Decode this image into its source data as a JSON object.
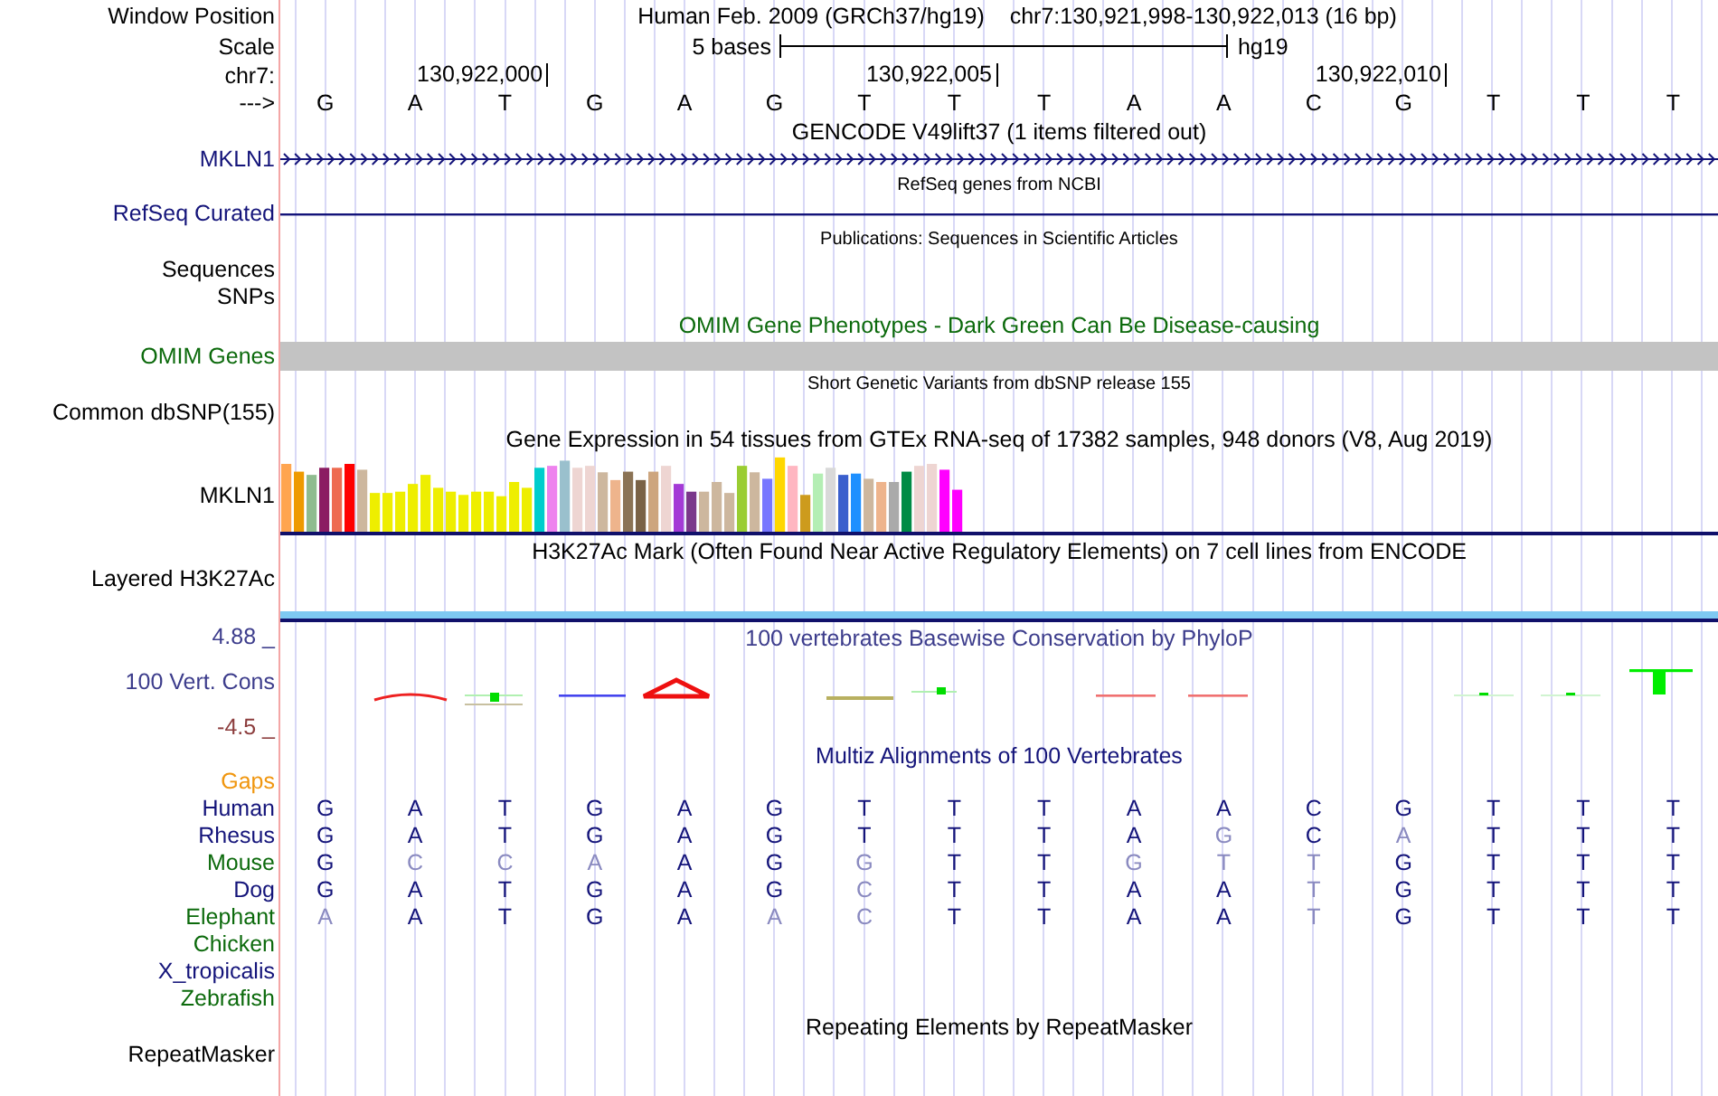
{
  "header": {
    "window_position_label": "Window Position",
    "assembly": "Human Feb. 2009 (GRCh37/hg19)",
    "position": "chr7:130,921,998-130,922,013 (16 bp)",
    "scale_label": "Scale",
    "scale_text": "5 bases",
    "scale_db": "hg19",
    "chrom_label": "chr7:",
    "strand_label": "--->",
    "bases": [
      {
        "b": "G"
      },
      {
        "b": "A"
      },
      {
        "b": "T",
        "tick": "130,922,000"
      },
      {
        "b": "G"
      },
      {
        "b": "A"
      },
      {
        "b": "G"
      },
      {
        "b": "T"
      },
      {
        "b": "T",
        "tick": "130,922,005"
      },
      {
        "b": "T"
      },
      {
        "b": "A"
      },
      {
        "b": "A"
      },
      {
        "b": "C"
      },
      {
        "b": "G",
        "tick": "130,922,010"
      },
      {
        "b": "T"
      },
      {
        "b": "T"
      },
      {
        "b": "T"
      }
    ]
  },
  "tracks": [
    {
      "kind": "gencode",
      "title": "GENCODE V49lift37 (1 items filtered out)",
      "label": "MKLN1"
    },
    {
      "kind": "refseq",
      "title": "RefSeq genes from NCBI",
      "label": "RefSeq Curated"
    },
    {
      "kind": "publications",
      "title": "Publications: Sequences in Scientific Articles",
      "labels": [
        "Sequences",
        "SNPs"
      ]
    },
    {
      "kind": "omim",
      "title": "OMIM Gene Phenotypes - Dark Green Can Be Disease-causing",
      "label": "OMIM Genes"
    },
    {
      "kind": "dbsnp",
      "title": "Short Genetic Variants from dbSNP release 155",
      "label": "Common dbSNP(155)"
    },
    {
      "kind": "gtex",
      "title": "Gene Expression in 54 tissues from GTEx RNA-seq of 17382 samples, 948 donors (V8, Aug 2019)",
      "label": "MKLN1"
    },
    {
      "kind": "h3k27ac",
      "title": "H3K27Ac Mark (Often Found Near Active Regulatory Elements) on 7 cell lines from ENCODE",
      "label": "Layered H3K27Ac"
    },
    {
      "kind": "phylop",
      "title": "100 vertebrates Basewise Conservation by PhyloP",
      "max": "4.88 _",
      "label": "100 Vert. Cons",
      "min": "-4.5 _"
    },
    {
      "kind": "multiz",
      "title": "Multiz Alignments of 100 Vertebrates",
      "gaps_label": "Gaps",
      "species": [
        {
          "name": "Human",
          "color": "#14147a",
          "bases": [
            {
              "b": "G",
              "dim": false
            },
            {
              "b": "A",
              "dim": false
            },
            {
              "b": "T",
              "dim": false
            },
            {
              "b": "G",
              "dim": false
            },
            {
              "b": "A",
              "dim": false
            },
            {
              "b": "G",
              "dim": false
            },
            {
              "b": "T",
              "dim": false
            },
            {
              "b": "T",
              "dim": false
            },
            {
              "b": "T",
              "dim": false
            },
            {
              "b": "A",
              "dim": false
            },
            {
              "b": "A",
              "dim": false
            },
            {
              "b": "C",
              "dim": false
            },
            {
              "b": "G",
              "dim": false
            },
            {
              "b": "T",
              "dim": false
            },
            {
              "b": "T",
              "dim": false
            },
            {
              "b": "T",
              "dim": false
            }
          ]
        },
        {
          "name": "Rhesus",
          "color": "#14147a",
          "bases": [
            {
              "b": "G",
              "dim": false
            },
            {
              "b": "A",
              "dim": false
            },
            {
              "b": "T",
              "dim": false
            },
            {
              "b": "G",
              "dim": false
            },
            {
              "b": "A",
              "dim": false
            },
            {
              "b": "G",
              "dim": false
            },
            {
              "b": "T",
              "dim": false
            },
            {
              "b": "T",
              "dim": false
            },
            {
              "b": "T",
              "dim": false
            },
            {
              "b": "A",
              "dim": false
            },
            {
              "b": "G",
              "dim": true
            },
            {
              "b": "C",
              "dim": false
            },
            {
              "b": "A",
              "dim": true
            },
            {
              "b": "T",
              "dim": false
            },
            {
              "b": "T",
              "dim": false
            },
            {
              "b": "T",
              "dim": false
            }
          ]
        },
        {
          "name": "Mouse",
          "color": "#0c6a0c",
          "bases": [
            {
              "b": "G",
              "dim": false
            },
            {
              "b": "C",
              "dim": true
            },
            {
              "b": "C",
              "dim": true
            },
            {
              "b": "A",
              "dim": true
            },
            {
              "b": "A",
              "dim": false
            },
            {
              "b": "G",
              "dim": false
            },
            {
              "b": "G",
              "dim": true
            },
            {
              "b": "T",
              "dim": false
            },
            {
              "b": "T",
              "dim": false
            },
            {
              "b": "G",
              "dim": true
            },
            {
              "b": "T",
              "dim": true
            },
            {
              "b": "T",
              "dim": true
            },
            {
              "b": "G",
              "dim": false
            },
            {
              "b": "T",
              "dim": false
            },
            {
              "b": "T",
              "dim": false
            },
            {
              "b": "T",
              "dim": false
            }
          ]
        },
        {
          "name": "Dog",
          "color": "#14147a",
          "bases": [
            {
              "b": "G",
              "dim": false
            },
            {
              "b": "A",
              "dim": false
            },
            {
              "b": "T",
              "dim": false
            },
            {
              "b": "G",
              "dim": false
            },
            {
              "b": "A",
              "dim": false
            },
            {
              "b": "G",
              "dim": false
            },
            {
              "b": "C",
              "dim": true
            },
            {
              "b": "T",
              "dim": false
            },
            {
              "b": "T",
              "dim": false
            },
            {
              "b": "A",
              "dim": false
            },
            {
              "b": "A",
              "dim": false
            },
            {
              "b": "T",
              "dim": true
            },
            {
              "b": "G",
              "dim": false
            },
            {
              "b": "T",
              "dim": false
            },
            {
              "b": "T",
              "dim": false
            },
            {
              "b": "T",
              "dim": false
            }
          ]
        },
        {
          "name": "Elephant",
          "color": "#0c6a0c",
          "bases": [
            {
              "b": "A",
              "dim": true
            },
            {
              "b": "A",
              "dim": false
            },
            {
              "b": "T",
              "dim": false
            },
            {
              "b": "G",
              "dim": false
            },
            {
              "b": "A",
              "dim": false
            },
            {
              "b": "A",
              "dim": true
            },
            {
              "b": "C",
              "dim": true
            },
            {
              "b": "T",
              "dim": false
            },
            {
              "b": "T",
              "dim": false
            },
            {
              "b": "A",
              "dim": false
            },
            {
              "b": "A",
              "dim": false
            },
            {
              "b": "T",
              "dim": true
            },
            {
              "b": "G",
              "dim": false
            },
            {
              "b": "T",
              "dim": false
            },
            {
              "b": "T",
              "dim": false
            },
            {
              "b": "T",
              "dim": false
            }
          ]
        },
        {
          "name": "Chicken",
          "color": "#0c6a0c"
        },
        {
          "name": "X_tropicalis",
          "color": "#14147a"
        },
        {
          "name": "Zebrafish",
          "color": "#0c6a0c"
        }
      ]
    },
    {
      "kind": "repeatmasker",
      "title": "Repeating Elements by RepeatMasker",
      "label": "RepeatMasker"
    }
  ]
}
